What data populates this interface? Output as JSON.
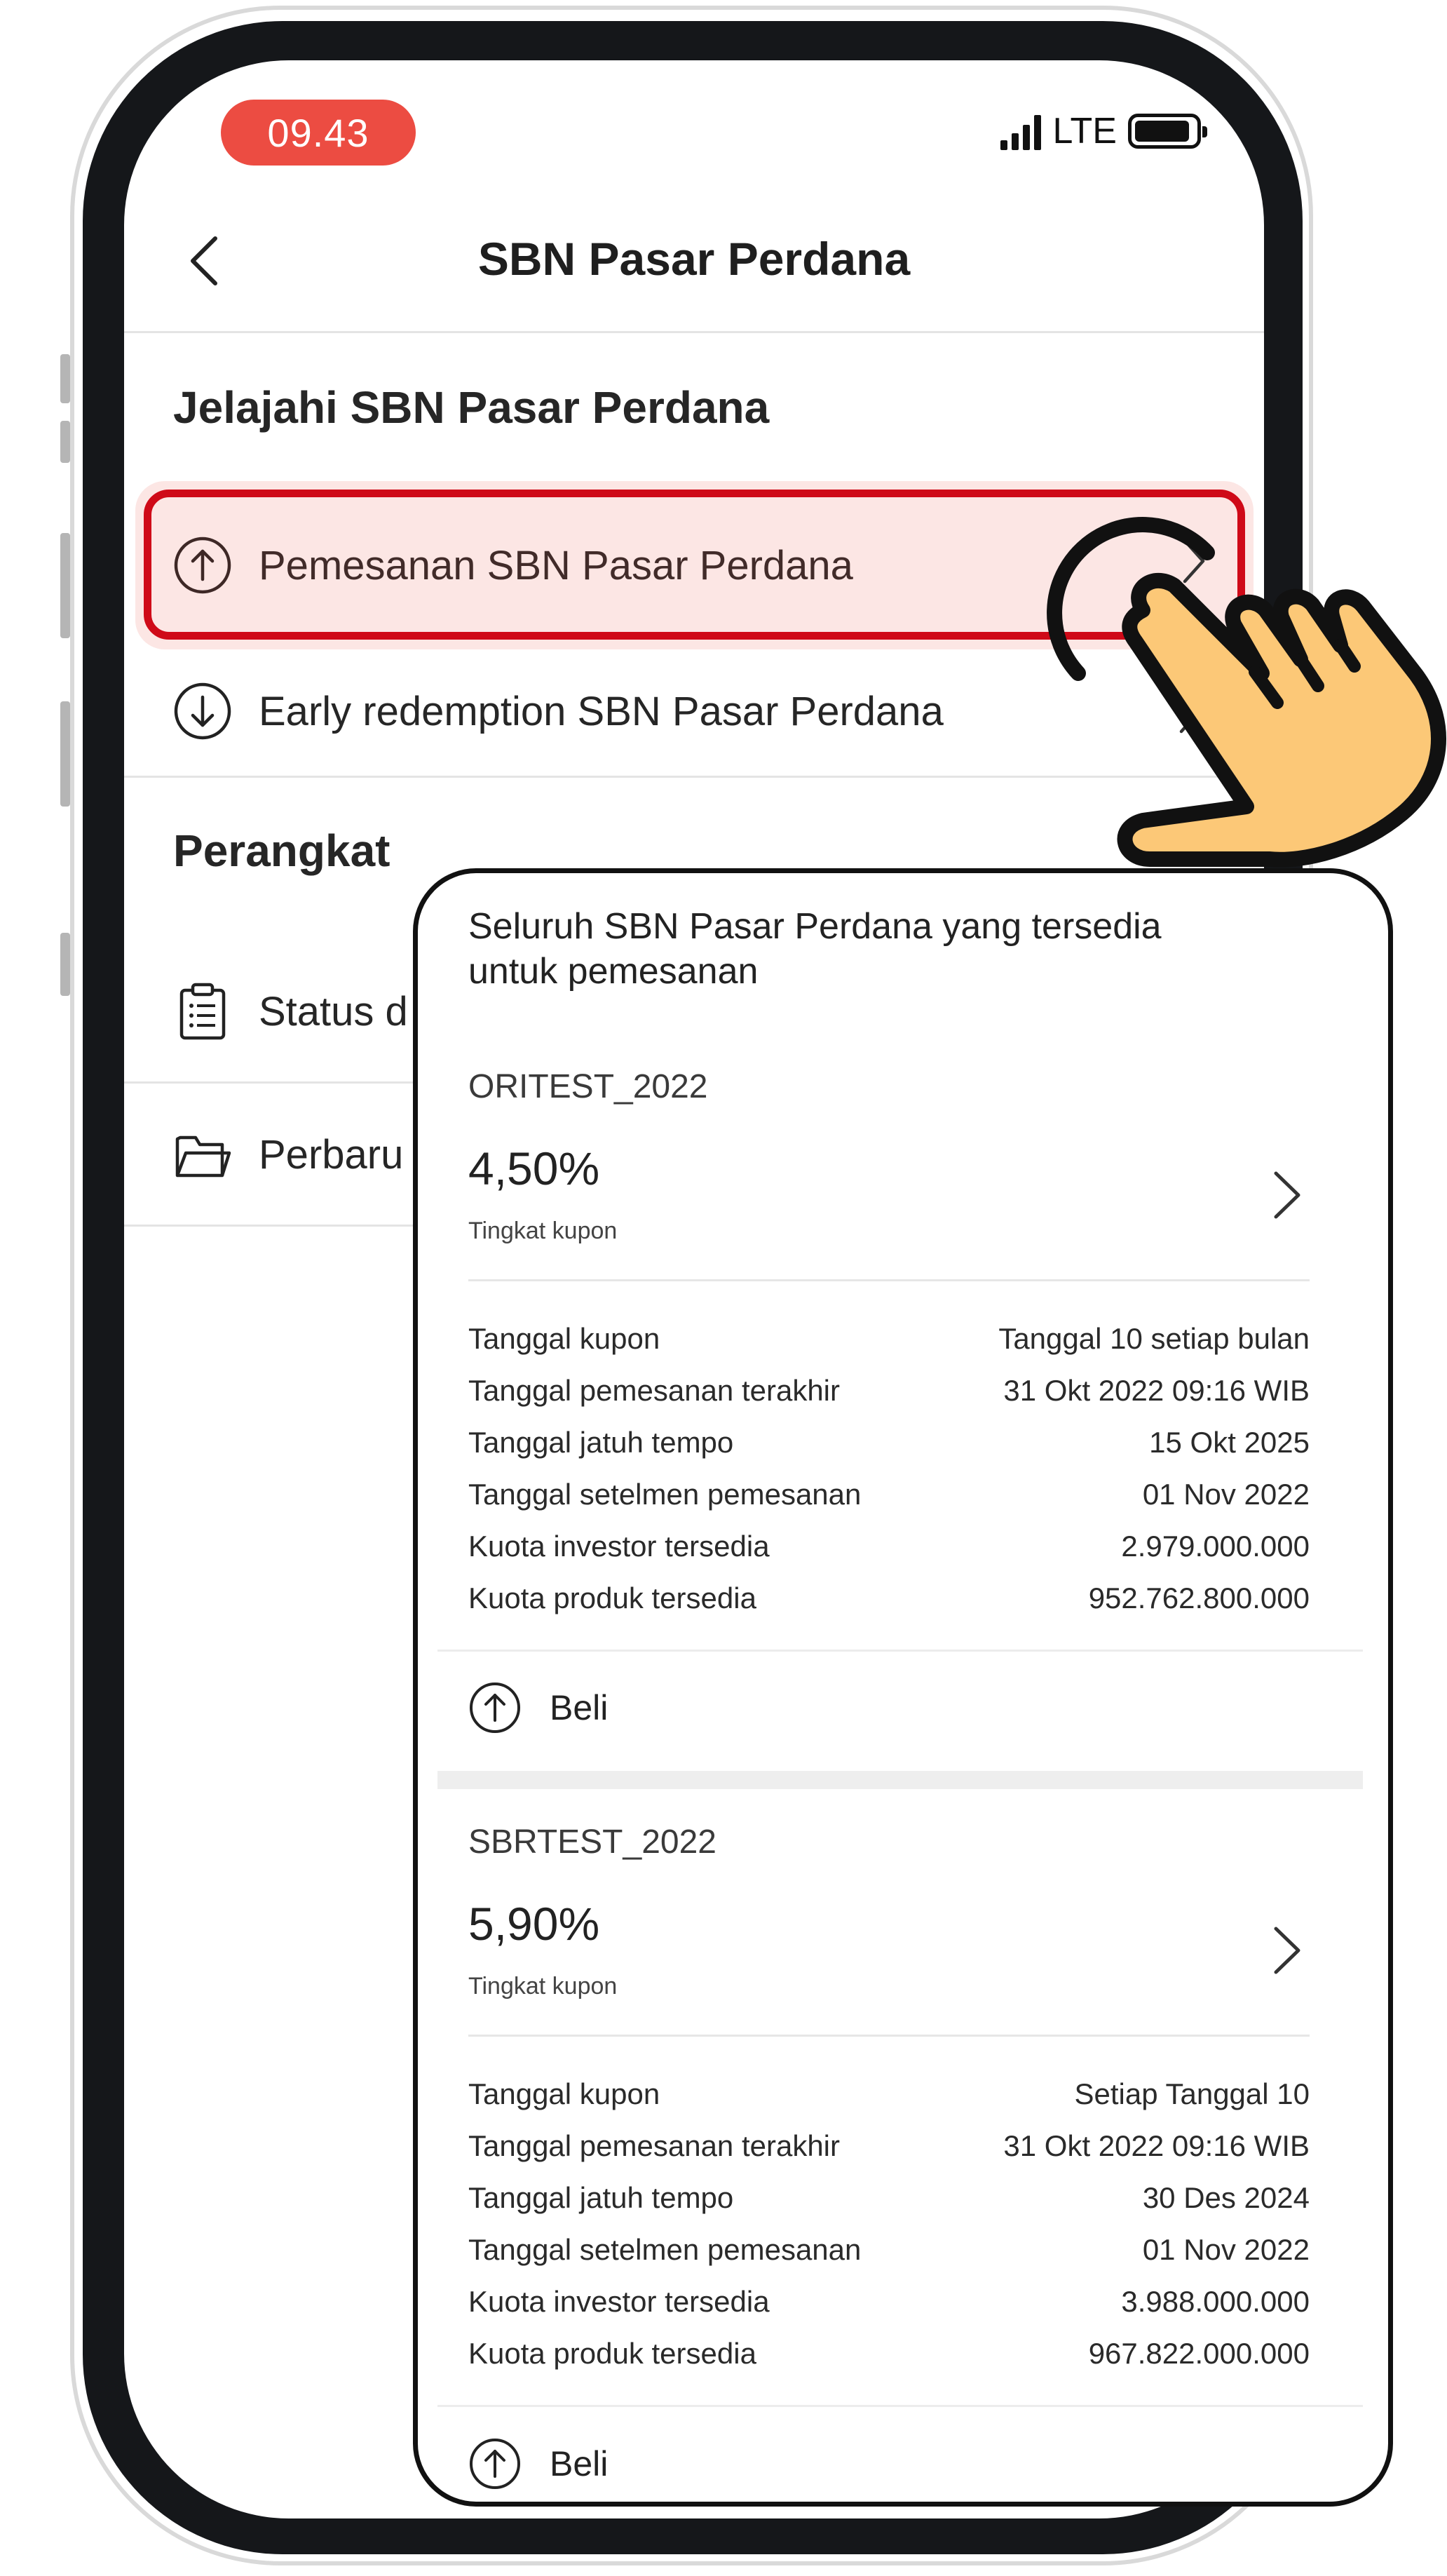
{
  "status_bar": {
    "time": "09.43",
    "network": "LTE"
  },
  "header": {
    "title": "SBN Pasar Perdana"
  },
  "explore_section": {
    "title": "Jelajahi SBN Pasar Perdana",
    "items": [
      {
        "label": "Pemesanan SBN Pasar Perdana",
        "icon": "arrow-up-circle-icon"
      },
      {
        "label": "Early redemption SBN Pasar Perdana",
        "icon": "arrow-down-circle-icon"
      }
    ]
  },
  "tools_section": {
    "title": "Perangkat",
    "items": [
      {
        "label": "Status d",
        "icon": "clipboard-icon"
      },
      {
        "label": "Perbaru",
        "icon": "folder-icon"
      }
    ]
  },
  "card": {
    "intro": "Seluruh SBN Pasar Perdana yang tersedia untuk pemesanan",
    "products": [
      {
        "code": "ORITEST_2022",
        "rate": "4,50%",
        "rate_label": "Tingkat kupon",
        "details": [
          {
            "label": "Tanggal kupon",
            "value": "Tanggal 10 setiap bulan"
          },
          {
            "label": "Tanggal pemesanan terakhir",
            "value": "31 Okt 2022 09:16 WIB"
          },
          {
            "label": "Tanggal jatuh tempo",
            "value": "15 Okt 2025"
          },
          {
            "label": "Tanggal setelmen pemesanan",
            "value": "01 Nov 2022"
          },
          {
            "label": "Kuota investor tersedia",
            "value": "2.979.000.000"
          },
          {
            "label": "Kuota produk tersedia",
            "value": "952.762.800.000"
          }
        ],
        "buy_label": "Beli"
      },
      {
        "code": "SBRTEST_2022",
        "rate": "5,90%",
        "rate_label": "Tingkat kupon",
        "details": [
          {
            "label": "Tanggal kupon",
            "value": "Setiap Tanggal 10"
          },
          {
            "label": "Tanggal pemesanan terakhir",
            "value": "31 Okt 2022 09:16 WIB"
          },
          {
            "label": "Tanggal jatuh tempo",
            "value": "30 Des 2024"
          },
          {
            "label": "Tanggal setelmen pemesanan",
            "value": "01 Nov 2022"
          },
          {
            "label": "Kuota investor tersedia",
            "value": "3.988.000.000"
          },
          {
            "label": "Kuota produk tersedia",
            "value": "967.822.000.000"
          }
        ],
        "buy_label": "Beli"
      }
    ]
  },
  "colors": {
    "accent_red": "#cf0a18",
    "time_pill": "#ec4c42",
    "hand_fill": "#fcc877",
    "frame": "#15171a"
  }
}
